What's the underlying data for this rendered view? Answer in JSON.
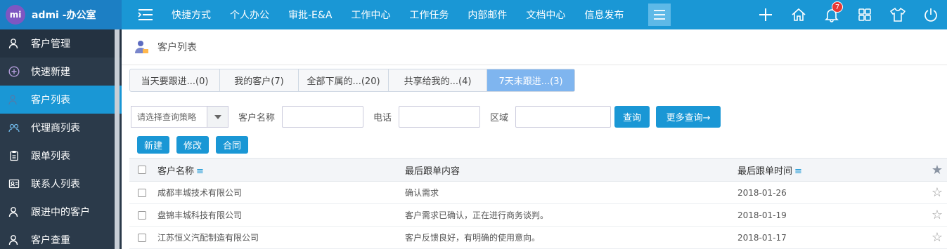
{
  "brand": {
    "logo_text": "mi",
    "name": "admi -办公室"
  },
  "sidebar": {
    "items": [
      {
        "label": "客户管理",
        "icon": "user-icon"
      },
      {
        "label": "快速新建",
        "icon": "plus-circle-icon"
      },
      {
        "label": "客户列表",
        "icon": "user-list-icon"
      },
      {
        "label": "代理商列表",
        "icon": "users-icon"
      },
      {
        "label": "跟单列表",
        "icon": "clipboard-icon"
      },
      {
        "label": "联系人列表",
        "icon": "contact-card-icon"
      },
      {
        "label": "跟进中的客户",
        "icon": "user-icon"
      },
      {
        "label": "客户查重",
        "icon": "user-icon"
      }
    ]
  },
  "topnav": {
    "items": [
      "快捷方式",
      "个人办公",
      "审批-E&A",
      "工作中心",
      "工作任务",
      "内部邮件",
      "文档中心",
      "信息发布"
    ],
    "notification_count": "7"
  },
  "page": {
    "title": "客户列表"
  },
  "tabs": [
    {
      "label": "当天要跟进...(0)"
    },
    {
      "label": "我的客户(7)"
    },
    {
      "label": "全部下属的...(20)"
    },
    {
      "label": "共享给我的...(4)"
    },
    {
      "label": "7天未跟进...(3)"
    }
  ],
  "filter": {
    "strategy_placeholder": "请选择查询策略",
    "name_label": "客户名称",
    "phone_label": "电话",
    "region_label": "区域",
    "search_button": "查询",
    "more_button": "更多查询→"
  },
  "actions": {
    "new": "新建",
    "edit": "修改",
    "contract": "合同"
  },
  "table": {
    "columns": [
      "客户名称",
      "最后跟单内容",
      "最后跟单时间"
    ],
    "rows": [
      {
        "name": "成都丰城技术有限公司",
        "content": "确认需求",
        "time": "2018-01-26"
      },
      {
        "name": "盘锦丰城科技有限公司",
        "content": "客户需求已确认，正在进行商务谈判。",
        "time": "2018-01-19"
      },
      {
        "name": "江苏恒义汽配制造有限公司",
        "content": "客户反馈良好，有明确的使用意向。",
        "time": "2018-01-17"
      }
    ]
  },
  "colors": {
    "primary": "#1a97d5",
    "sidebar": "#2b3a4a",
    "active_tab": "#7fb5ef",
    "badge": "#e53935"
  }
}
